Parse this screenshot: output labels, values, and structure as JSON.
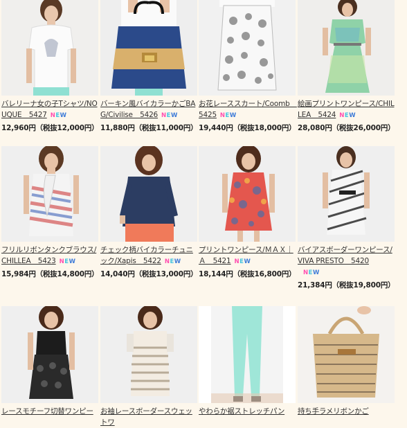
{
  "new_badge": {
    "n": "N",
    "e": "E",
    "w": "W"
  },
  "products": [
    {
      "title": "バレリーナ女の子Tシャツ/NOUQUE　5427",
      "price": "12,960円（税抜12,000円）",
      "new": true
    },
    {
      "title": "バーキン風バイカラーかごBAG/Civilise　5426",
      "price": "11,880円（税抜11,000円）",
      "new": true
    },
    {
      "title": "お花レーススカート/Coomb　5425",
      "price": "19,440円（税抜18,000円）",
      "new": true
    },
    {
      "title": "絵画プリントワンピース/CHILLEA　5424",
      "price": "28,080円（税抜26,000円）",
      "new": true
    },
    {
      "title": "フリルリボンタンクブラウス/CHILLEA　5423",
      "price": "15,984円（税抜14,800円）",
      "new": true
    },
    {
      "title": "チェック柄バイカラーチュニック/Xapis　5422",
      "price": "14,040円（税抜13,000円）",
      "new": true
    },
    {
      "title": "プリントワンピース/ＭＡＸ｜Ａ　5421",
      "price": "18,144円（税抜16,800円）",
      "new": true
    },
    {
      "title": "バイアスボーダーワンピース/VIVA PRESTO　5420",
      "price": "21,384円（税抜19,800円）",
      "new": true
    },
    {
      "title": "レースモチーフ切替ワンピー",
      "price": "",
      "new": false
    },
    {
      "title": "お袖レースボーダースウェットワ",
      "price": "",
      "new": false
    },
    {
      "title": "やわらか裾ストレッチパン",
      "price": "",
      "new": false
    },
    {
      "title": "持ち手ラメリボンかご",
      "price": "",
      "new": false
    }
  ]
}
